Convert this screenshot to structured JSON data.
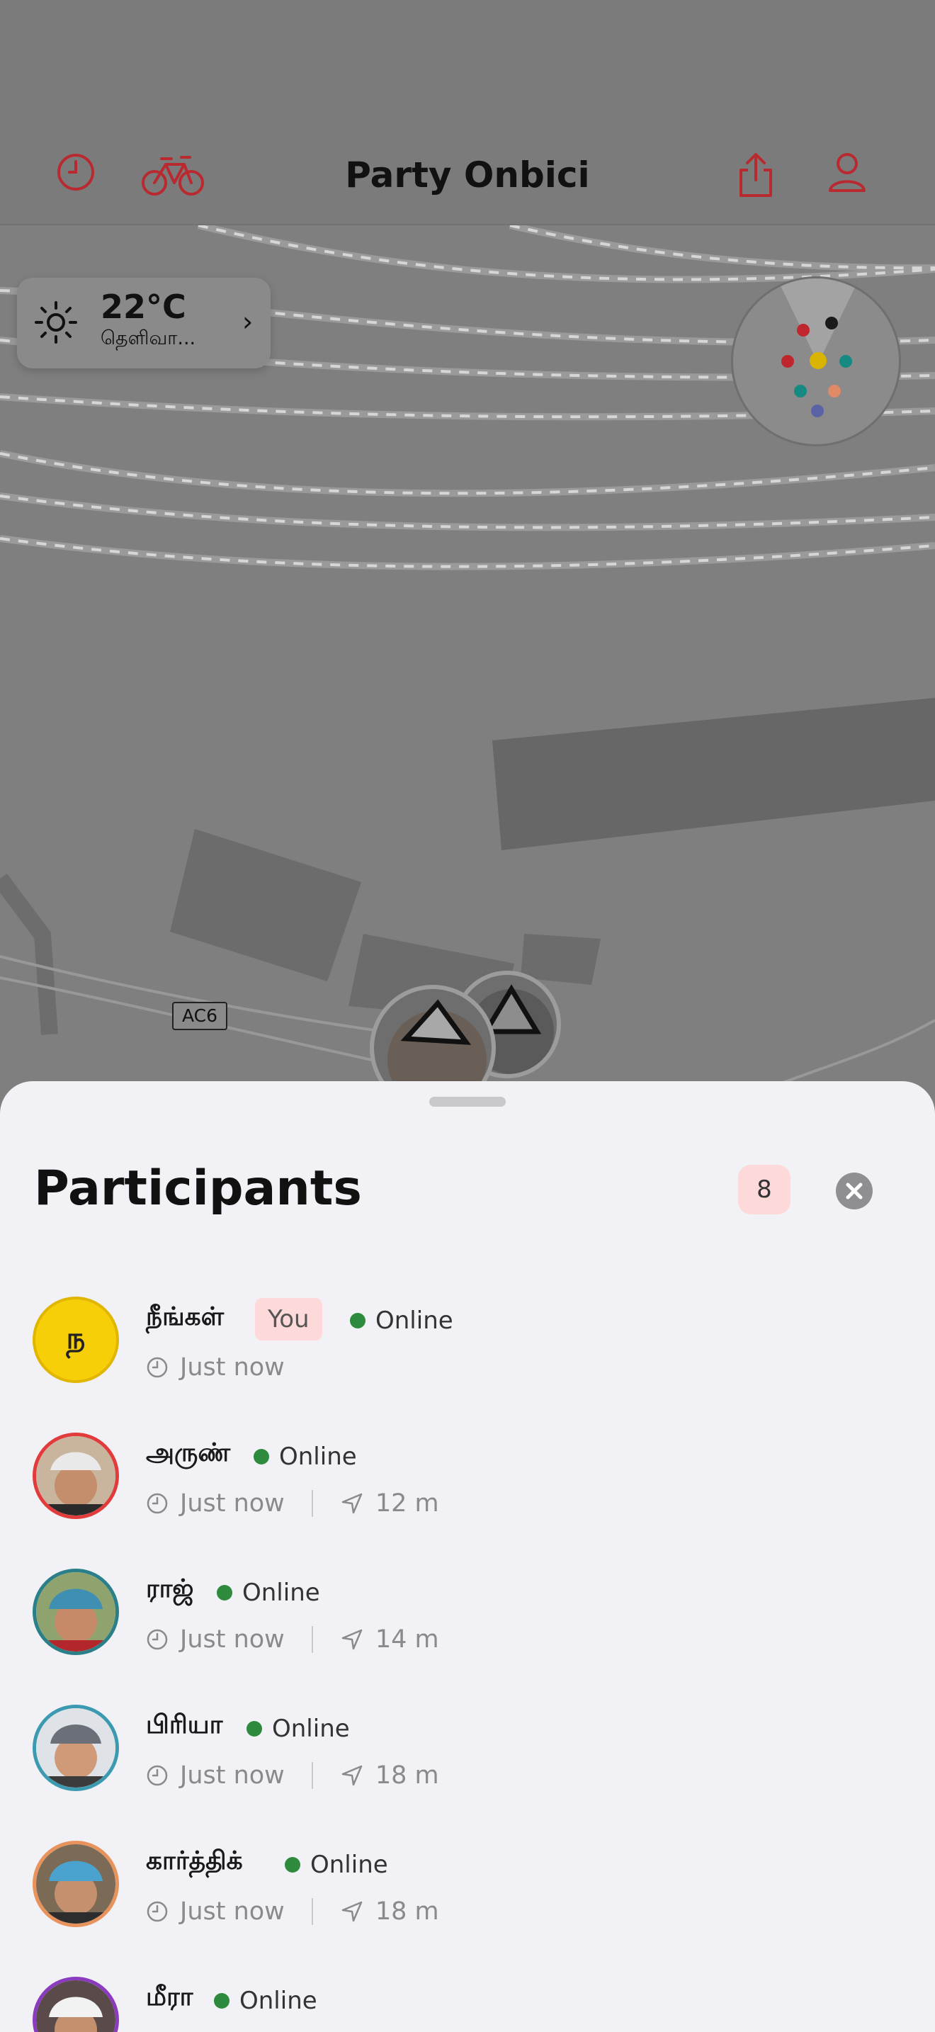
{
  "app": {
    "title": "Party Onbici"
  },
  "toolbar": {
    "history_icon": "clock-icon",
    "bike_icon": "bicycle-icon",
    "share_icon": "share-icon",
    "profile_icon": "person-icon"
  },
  "weather": {
    "temperature": "22°C",
    "condition": "தெளிவா..."
  },
  "map": {
    "road_label": "AC6"
  },
  "sheet": {
    "title": "Participants",
    "count": "8"
  },
  "participants": [
    {
      "name": "நீங்கள்",
      "initial": "ந",
      "you_label": "You",
      "status": "Online",
      "updated": "Just now",
      "distance": ""
    },
    {
      "name": "அருண்",
      "status": "Online",
      "updated": "Just now",
      "distance": "12 m"
    },
    {
      "name": "ராஜ்",
      "status": "Online",
      "updated": "Just now",
      "distance": "14 m"
    },
    {
      "name": "பிரியா",
      "status": "Online",
      "updated": "Just now",
      "distance": "18 m"
    },
    {
      "name": "கார்த்திக்",
      "status": "Online",
      "updated": "Just now",
      "distance": "18 m"
    },
    {
      "name": "மீரா",
      "status": "Online",
      "updated": "",
      "distance": ""
    }
  ],
  "colors": {
    "accent": "#c0262d",
    "online": "#2e8b3e",
    "badge_bg": "#fdd9d9",
    "me_avatar": "#f7cf08"
  }
}
